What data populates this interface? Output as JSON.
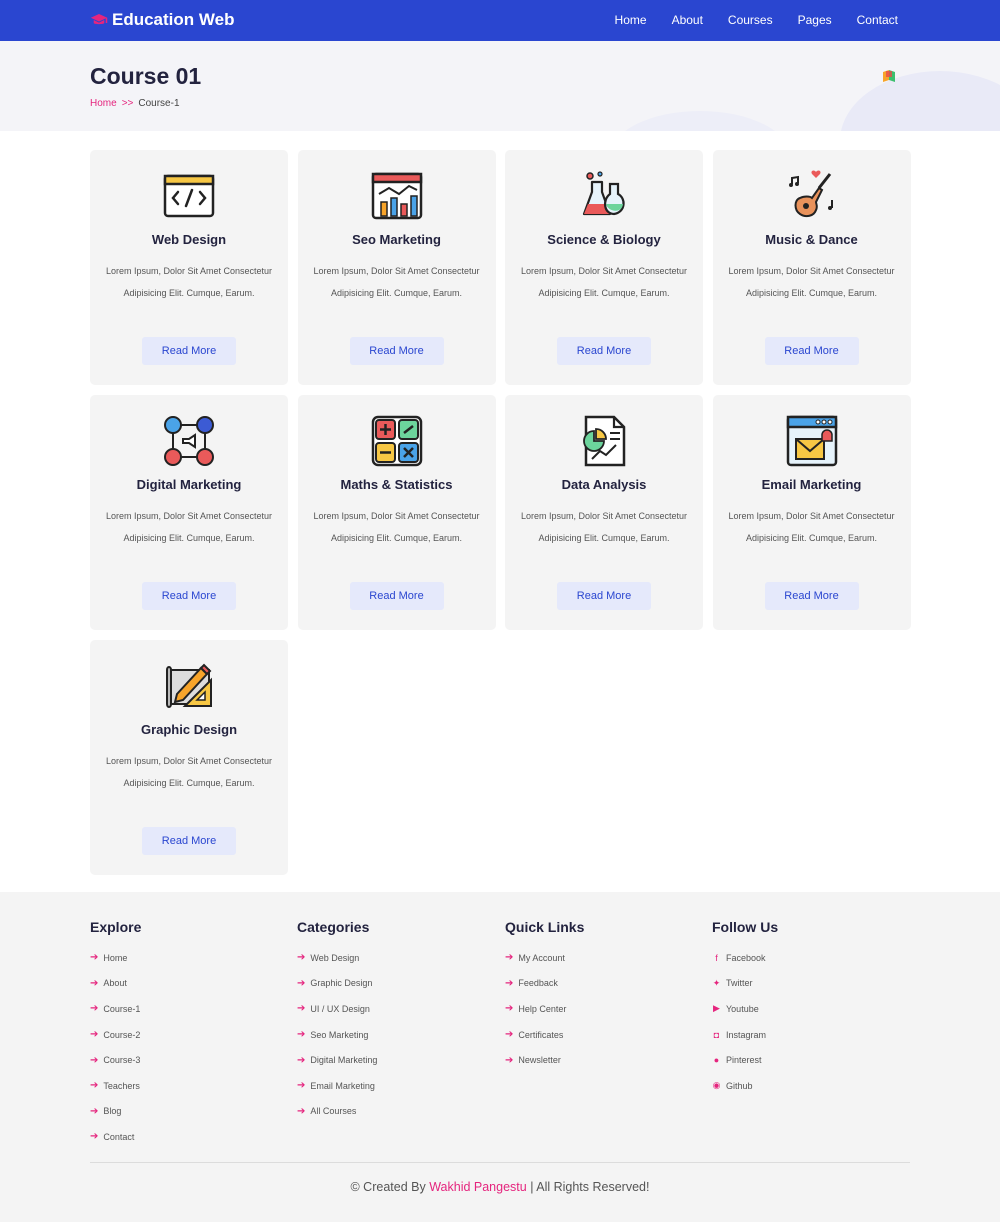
{
  "nav": {
    "brand": "Education Web",
    "links": [
      "Home",
      "About",
      "Courses",
      "Pages",
      "Contact"
    ]
  },
  "header": {
    "title": "Course 01",
    "breadcrumb_home": "Home",
    "breadcrumb_sep": ">>",
    "breadcrumb_current": "Course-1"
  },
  "cards": [
    {
      "icon": "code-window-icon",
      "title": "Web Design",
      "desc": "Lorem Ipsum, Dolor Sit Amet Consectetur Adipisicing Elit. Cumque, Earum.",
      "button": "Read More"
    },
    {
      "icon": "analytics-dashboard-icon",
      "title": "Seo Marketing",
      "desc": "Lorem Ipsum, Dolor Sit Amet Consectetur Adipisicing Elit. Cumque, Earum.",
      "button": "Read More"
    },
    {
      "icon": "flask-icon",
      "title": "Science & Biology",
      "desc": "Lorem Ipsum, Dolor Sit Amet Consectetur Adipisicing Elit. Cumque, Earum.",
      "button": "Read More"
    },
    {
      "icon": "guitar-icon",
      "title": "Music & Dance",
      "desc": "Lorem Ipsum, Dolor Sit Amet Consectetur Adipisicing Elit. Cumque, Earum.",
      "button": "Read More"
    },
    {
      "icon": "social-media-icon",
      "title": "Digital Marketing",
      "desc": "Lorem Ipsum, Dolor Sit Amet Consectetur Adipisicing Elit. Cumque, Earum.",
      "button": "Read More"
    },
    {
      "icon": "calculator-icon",
      "title": "Maths & Statistics",
      "desc": "Lorem Ipsum, Dolor Sit Amet Consectetur Adipisicing Elit. Cumque, Earum.",
      "button": "Read More"
    },
    {
      "icon": "report-chart-icon",
      "title": "Data Analysis",
      "desc": "Lorem Ipsum, Dolor Sit Amet Consectetur Adipisicing Elit. Cumque, Earum.",
      "button": "Read More"
    },
    {
      "icon": "email-window-icon",
      "title": "Email Marketing",
      "desc": "Lorem Ipsum, Dolor Sit Amet Consectetur Adipisicing Elit. Cumque, Earum.",
      "button": "Read More"
    },
    {
      "icon": "pencil-ruler-icon",
      "title": "Graphic Design",
      "desc": "Lorem Ipsum, Dolor Sit Amet Consectetur Adipisicing Elit. Cumque, Earum.",
      "button": "Read More"
    }
  ],
  "footer": {
    "explore": {
      "heading": "Explore",
      "items": [
        "Home",
        "About",
        "Course-1",
        "Course-2",
        "Course-3",
        "Teachers",
        "Blog",
        "Contact"
      ]
    },
    "categories": {
      "heading": "Categories",
      "items": [
        "Web Design",
        "Graphic Design",
        "UI / UX Design",
        "Seo Marketing",
        "Digital Marketing",
        "Email Marketing",
        "All Courses"
      ]
    },
    "quick_links": {
      "heading": "Quick Links",
      "items": [
        "My Account",
        "Feedback",
        "Help Center",
        "Certificates",
        "Newsletter"
      ]
    },
    "follow": {
      "heading": "Follow Us",
      "items": [
        {
          "icon": "facebook-icon",
          "label": "Facebook"
        },
        {
          "icon": "twitter-icon",
          "label": "Twitter"
        },
        {
          "icon": "youtube-icon",
          "label": "Youtube"
        },
        {
          "icon": "instagram-icon",
          "label": "Instagram"
        },
        {
          "icon": "pinterest-icon",
          "label": "Pinterest"
        },
        {
          "icon": "github-icon",
          "label": "Github"
        }
      ]
    },
    "credit_prefix": "© Created By",
    "credit_name": "Wakhid Pangestu",
    "credit_suffix": "| All Rights Reserved!"
  },
  "colors": {
    "primary": "#2a46d0",
    "accent": "#e5257e",
    "card_bg": "#f4f4f4",
    "button_bg": "#e5e9fb"
  }
}
